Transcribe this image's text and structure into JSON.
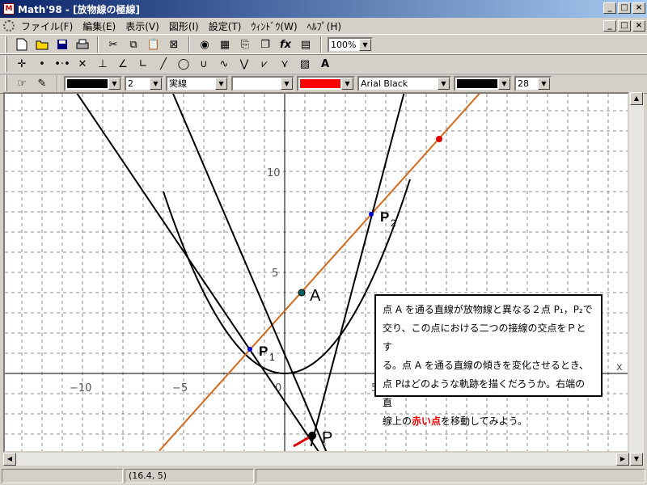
{
  "window": {
    "title": "Math'98 - [放物線の極線]",
    "min_label": "_",
    "max_label": "□",
    "close_label": "×"
  },
  "menu": {
    "items": [
      "ファイル(F)",
      "編集(E)",
      "表示(V)",
      "図形(I)",
      "設定(T)",
      "ｳｨﾝﾄﾞｳ(W)",
      "ﾍﾙﾌﾟ(H)"
    ]
  },
  "toolbar1": {
    "zoom": "100%"
  },
  "toolbar3": {
    "line_width": "2",
    "line_style": "実線",
    "font_name": "Arial Black",
    "font_size": "28",
    "line_color": "#000000",
    "fill_color": "#ff0000",
    "text_color": "#000000"
  },
  "graph": {
    "x_ticks": [
      "−10",
      "−5",
      "0",
      "5"
    ],
    "y_ticks": [
      "10",
      "5"
    ],
    "point_labels": {
      "A": "A",
      "P": "P",
      "P1": "P",
      "P1_sub": "1",
      "P2": "P",
      "P2_sub": "2"
    },
    "x_axis_symbol": "x"
  },
  "note": {
    "lines": [
      "点 A を通る直線が放物線と異なる２点 P₁，P₂で",
      "交り、この点における二つの接線の交点をＰとす",
      "る。点 A を通る直線の傾きを変化させるとき、",
      "点 Pはどのような軌跡を描くだろうか。右端の直"
    ],
    "last_line_prefix": "線上の",
    "last_line_red": "赤い点",
    "last_line_suffix": "を移動してみよう。"
  },
  "status": {
    "coords": "(16.4, 5)"
  },
  "colors": {
    "title_gradient_start": "#0a246a",
    "secant_line": "#d2691e",
    "red_point": "#e00000",
    "point_blue": "#0000cc"
  }
}
